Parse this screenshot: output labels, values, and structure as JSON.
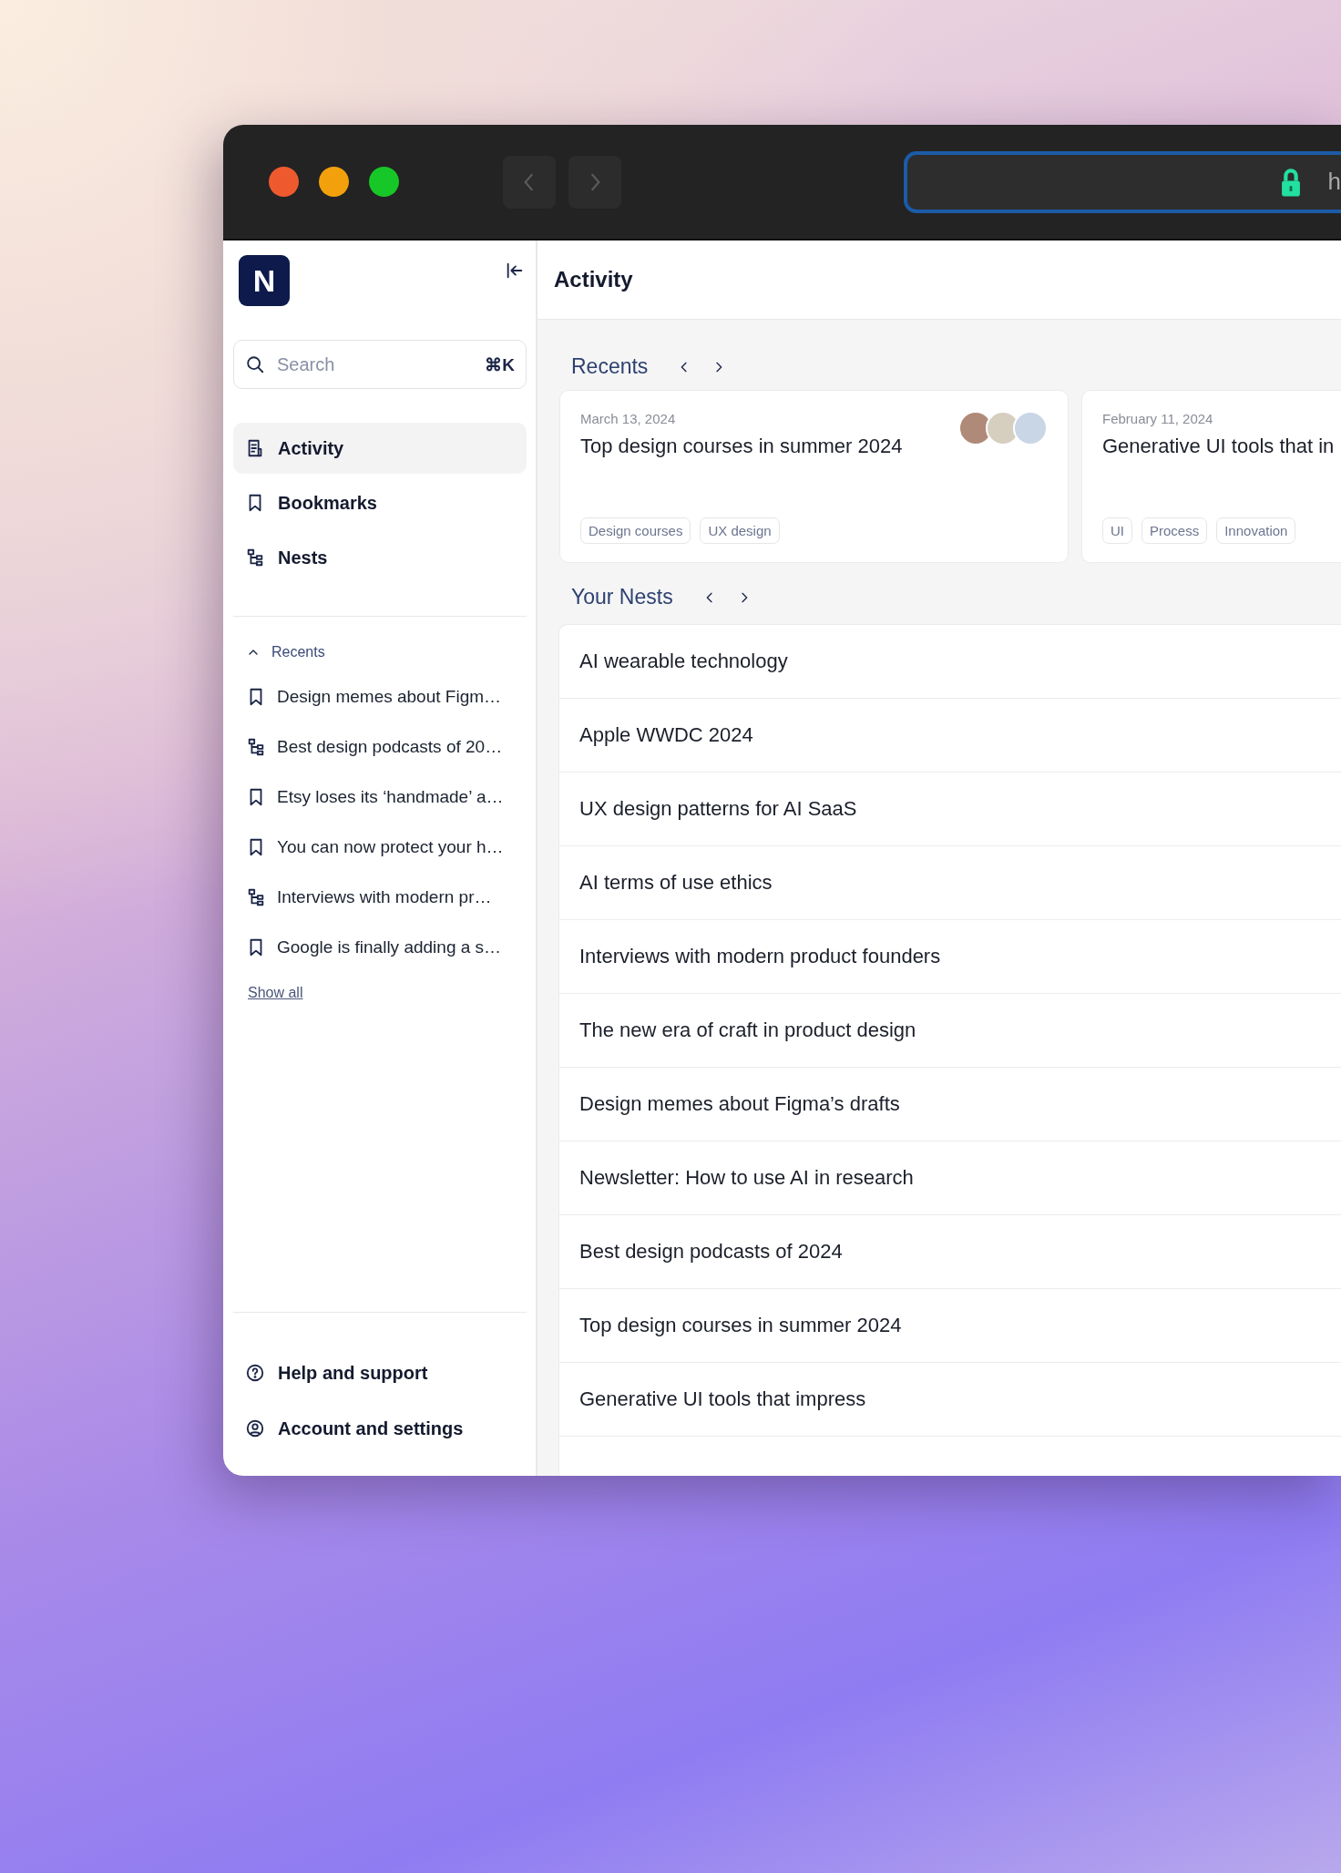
{
  "browser": {
    "url": "h"
  },
  "sidebar": {
    "logo": "N",
    "search": {
      "placeholder": "Search",
      "shortcut": "⌘K"
    },
    "nav": [
      {
        "label": "Activity",
        "kind": "activity",
        "selected": true
      },
      {
        "label": "Bookmarks",
        "kind": "bookmark",
        "selected": false
      },
      {
        "label": "Nests",
        "kind": "nest",
        "selected": false
      }
    ],
    "recents": {
      "title": "Recents",
      "expanded": true,
      "items": [
        {
          "title": "Design memes about Figm…",
          "kind": "bookmark"
        },
        {
          "title": "Best design podcasts of 20…",
          "kind": "nest"
        },
        {
          "title": "Etsy loses its ‘handmade’ a…",
          "kind": "bookmark"
        },
        {
          "title": "You can now protect your h…",
          "kind": "bookmark"
        },
        {
          "title": "Interviews with modern pr…",
          "kind": "nest"
        },
        {
          "title": "Google is finally adding a s…",
          "kind": "bookmark"
        }
      ],
      "show_all": "Show all"
    },
    "footer": [
      {
        "label": "Help and support",
        "kind": "help"
      },
      {
        "label": "Account and settings",
        "kind": "account"
      }
    ]
  },
  "main": {
    "title": "Activity",
    "recents": {
      "title": "Recents",
      "cards": [
        {
          "date": "March 13, 2024",
          "title": "Top design courses in summer 2024",
          "shared": true,
          "tags": [
            "Design courses",
            "UX design"
          ]
        },
        {
          "date": "February 11, 2024",
          "title": "Generative UI tools that in",
          "tags": [
            "UI",
            "Process",
            "Innovation"
          ]
        }
      ]
    },
    "nests": {
      "title": "Your Nests",
      "items": [
        "AI wearable technology",
        "Apple WWDC 2024",
        "UX design patterns for AI SaaS",
        "AI terms of use ethics",
        "Interviews with modern product founders",
        "The new era of craft in product design",
        "Design memes about Figma’s drafts",
        "Newsletter: How to use AI in research",
        "Best design podcasts of 2024",
        "Top design courses in summer 2024",
        "Generative UI tools that impress"
      ]
    }
  }
}
